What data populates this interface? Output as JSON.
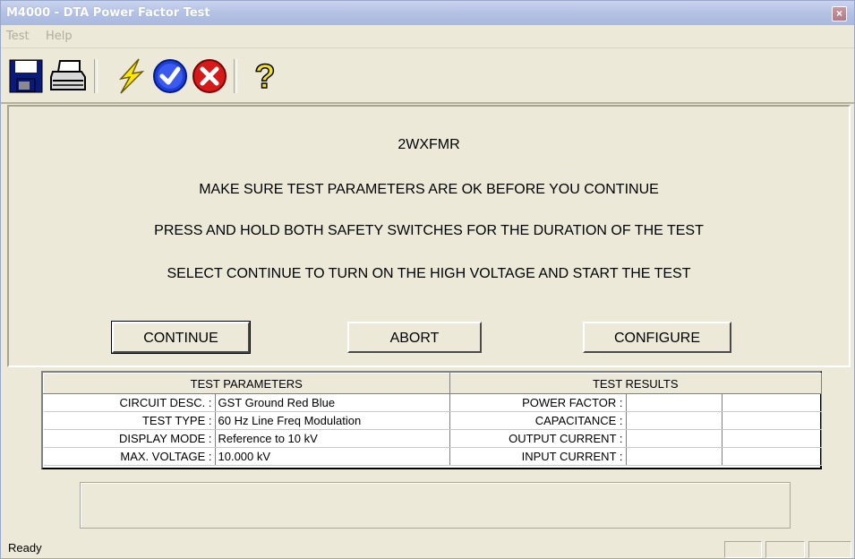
{
  "window": {
    "title": "M4000 - DTA Power Factor Test",
    "close_glyph": "×"
  },
  "menu": [
    {
      "label": "Test"
    },
    {
      "label": "Help"
    }
  ],
  "toolbar": {
    "icons": [
      "save-icon",
      "print-icon",
      "lightning-icon",
      "check-icon",
      "cancel-icon",
      "help-icon"
    ]
  },
  "instructions": {
    "equipment_id": "2WXFMR",
    "line1": "MAKE SURE TEST PARAMETERS ARE OK BEFORE YOU CONTINUE",
    "line2": "PRESS AND HOLD BOTH SAFETY SWITCHES FOR THE DURATION OF THE TEST",
    "line3": "SELECT CONTINUE TO TURN ON THE HIGH VOLTAGE AND START THE TEST"
  },
  "buttons": {
    "continue": "CONTINUE",
    "abort": "ABORT",
    "configure": "CONFIGURE"
  },
  "table": {
    "headers": {
      "params": "TEST PARAMETERS",
      "results": "TEST RESULTS"
    },
    "rows": [
      {
        "label": "CIRCUIT DESC. :",
        "value": "GST Ground Red Blue",
        "result_label": "POWER FACTOR :",
        "result_value": "",
        "result_value2": ""
      },
      {
        "label": "TEST TYPE :",
        "value": "60 Hz Line Freq Modulation",
        "result_label": "CAPACITANCE :",
        "result_value": "",
        "result_value2": ""
      },
      {
        "label": "DISPLAY MODE :",
        "value": "Reference to 10 kV",
        "result_label": "OUTPUT CURRENT :",
        "result_value": "",
        "result_value2": ""
      },
      {
        "label": "MAX. VOLTAGE :",
        "value": "10.000 kV",
        "result_label": "INPUT CURRENT :",
        "result_value": "",
        "result_value2": ""
      }
    ]
  },
  "status": {
    "text": "Ready"
  },
  "colors": {
    "titlebar": "#b3c1e4",
    "face": "#ece9d8"
  }
}
